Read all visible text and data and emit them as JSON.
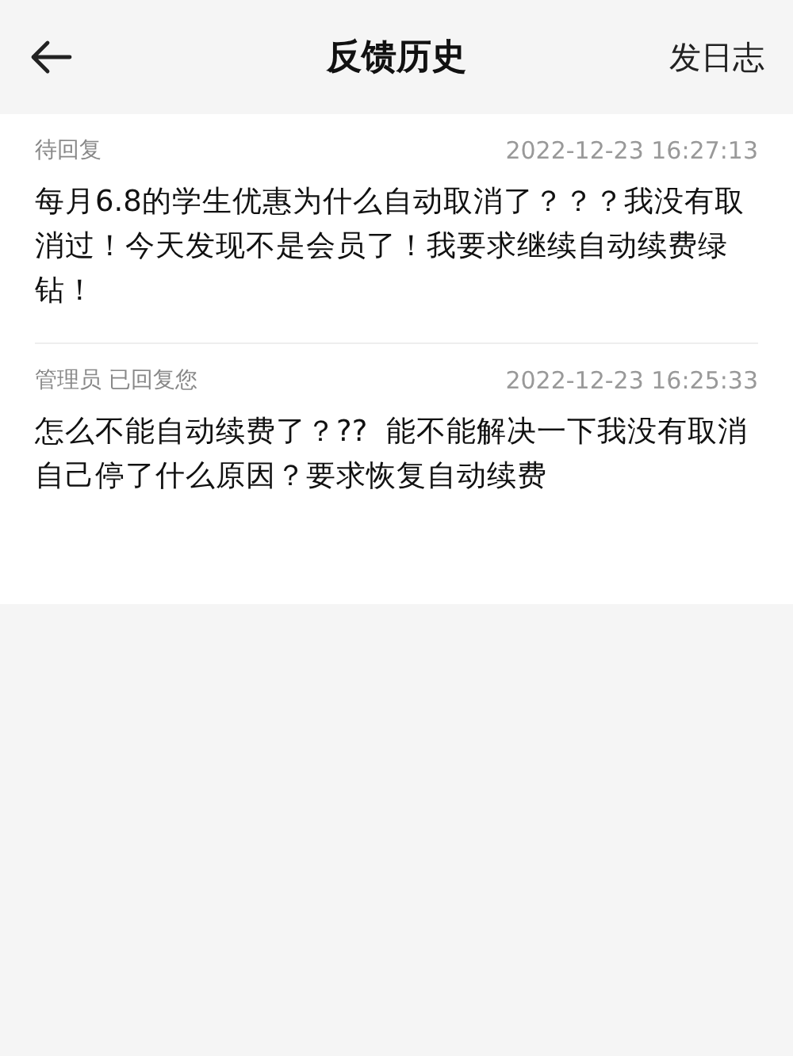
{
  "header": {
    "title": "反馈历史",
    "action": "发日志"
  },
  "feedback": [
    {
      "status": "待回复",
      "time": "2022-12-23 16:27:13",
      "message": "每月6.8的学生优惠为什么自动取消了？？？我没有取消过！今天发现不是会员了！我要求继续自动续费绿钻！"
    },
    {
      "status": "管理员 已回复您",
      "time": "2022-12-23 16:25:33",
      "message": "怎么不能自动续费了？??  能不能解决一下我没有取消自己停了什么原因？要求恢复自动续费"
    }
  ]
}
